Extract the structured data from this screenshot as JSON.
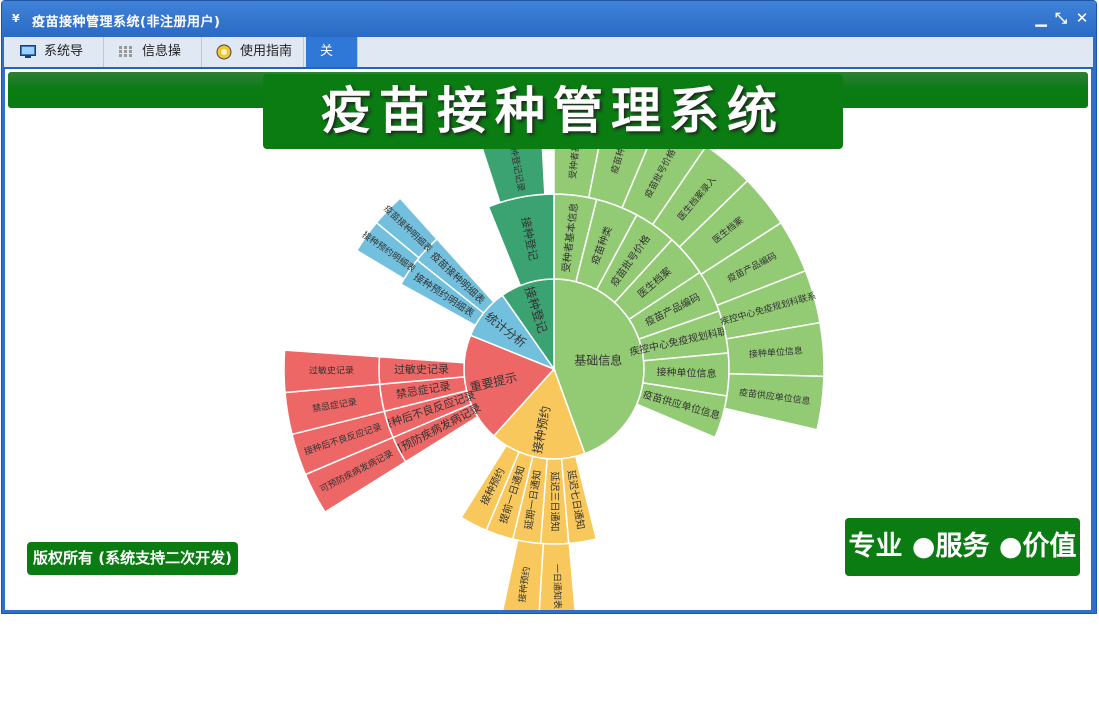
{
  "window": {
    "title": "疫苗接种管理系统(非注册用户)",
    "buttons": {
      "minimize": "▁",
      "restore": "⤡",
      "close": "✕"
    }
  },
  "menu": [
    {
      "label": "系统导航",
      "icon": "monitor-icon"
    },
    {
      "label": "信息操作",
      "icon": "grid-icon"
    },
    {
      "label": "使用指南",
      "icon": "guide-icon"
    },
    {
      "label": "关于",
      "icon": ""
    }
  ],
  "banner": {
    "title": "疫苗接种管理系统"
  },
  "footer": {
    "copyright": "版权所有 (系统支持二次开发)",
    "slogan": "专业 ●服务 ●价值"
  },
  "sunburst": {
    "center": [
      "基础信息",
      "接种预约",
      "重要提示",
      "统计分析",
      "接种登记"
    ],
    "ring2": {
      "基础信息": [
        "受种者基本信息",
        "疫苗种类",
        "疫苗批号价格",
        "医生档案",
        "疫苗产品编码",
        "疾控中心免疫规划科联系",
        "接种单位信息",
        "疫苗供应单位信息"
      ],
      "接种预约": [
        "延迟七日通知",
        "延迟三日通知",
        "延期一日通知",
        "提前一日通知",
        "接种预约"
      ],
      "重要提示": [
        "可预防疾病发病记录",
        "接种后不良反应记录",
        "禁忌症记录",
        "过敏史记录"
      ],
      "统计分析": [
        "接种预约明细表",
        "疫苗接种明细表"
      ],
      "接种登记": [
        "接种登记"
      ]
    },
    "ring3": [
      "受种者基本信息",
      "疫苗种类",
      "疫苗批号价格",
      "医生档案录入",
      "医生档案",
      "疫苗产品编码",
      "疾控中心免疫规划科联系",
      "接种单位信息",
      "疫苗供应单位信息",
      "可预防疾病发病记录",
      "接种后不良反应记录",
      "禁忌症记录",
      "过敏史记录",
      "接种预约明细表",
      "疫苗接种明细表",
      "接种登记记录",
      "一日通知表",
      "接种预约"
    ],
    "colors": {
      "基础信息": "#93cb75",
      "接种预约": "#f9c85c",
      "重要提示": "#ee6767",
      "统计分析": "#73c0de",
      "接种登记": "#3ba272"
    }
  }
}
